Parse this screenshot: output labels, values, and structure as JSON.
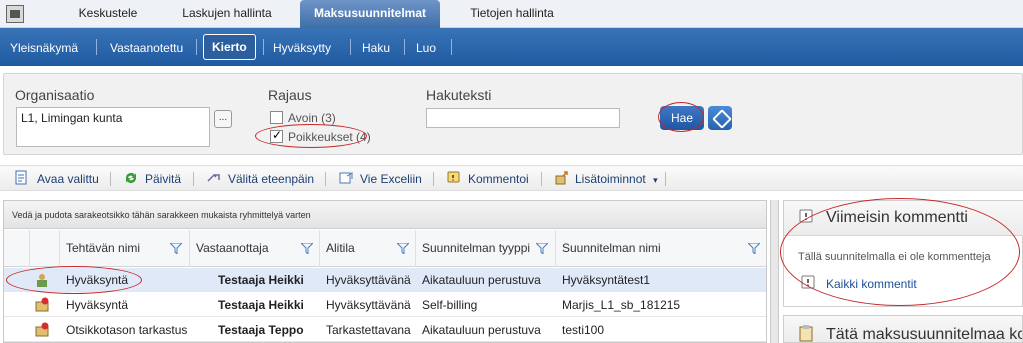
{
  "top_tabs": [
    "Keskustele",
    "Laskujen hallinta",
    "Maksusuunnitelmat",
    "Tietojen hallinta"
  ],
  "sub_nav": [
    "Yleisnäkymä",
    "Vastaanotettu",
    "Kierto",
    "Hyväksytty",
    "Haku",
    "Luo"
  ],
  "filters": {
    "organisaatio_label": "Organisaatio",
    "organisaatio_value": "L1, Limingan kunta",
    "dots_button": "...",
    "rajaus_label": "Rajaus",
    "avoin": "Avoin (3)",
    "poikkeukset": "Poikkeukset (4)",
    "hakuteksti_label": "Hakuteksti",
    "hakuteksti_value": "",
    "hae_button": "Hae"
  },
  "toolbar": {
    "avaa": "Avaa valittu",
    "paivita": "Päivitä",
    "valita": "Välitä eteenpäin",
    "vie": "Vie Exceliin",
    "kommentoi": "Kommentoi",
    "lisatoiminnot": "Lisätoiminnot",
    "lisatoiminnot_arrow": "▾"
  },
  "grid": {
    "group_hint": "Vedä ja pudota sarakeotsikko tähän sarakkeen mukaista ryhmittelyä varten",
    "columns": [
      "Tehtävän nimi",
      "Vastaanottaja",
      "Alitila",
      "Suunnitelman tyyppi",
      "Suunnitelman nimi"
    ],
    "rows": [
      [
        "Hyväksyntä",
        "Testaaja Heikki",
        "Hyväksyttävänä",
        "Aikatauluun perustuva",
        "Hyväksyntätest1"
      ],
      [
        "Hyväksyntä",
        "Testaaja Heikki",
        "Hyväksyttävänä",
        "Self-billing",
        "Marjis_L1_sb_181215"
      ],
      [
        "Otsikkotason tarkastus",
        "Testaaja Teppo",
        "Tarkastettavana",
        "Aikatauluun perustuva",
        "testi100"
      ]
    ]
  },
  "right_panel": {
    "title": "Viimeisin kommentti",
    "empty_text": "Tällä suunnitelmalla ei ole kommentteja",
    "link": "Kaikki kommentit",
    "second_title": "Tätä maksusuunnitelmaa kos"
  },
  "colors": {
    "nav_blue": "#2a66ad",
    "link_blue": "#1d4f9a",
    "annotation_red": "#c62828",
    "selected_row": "#dfe9f8"
  }
}
